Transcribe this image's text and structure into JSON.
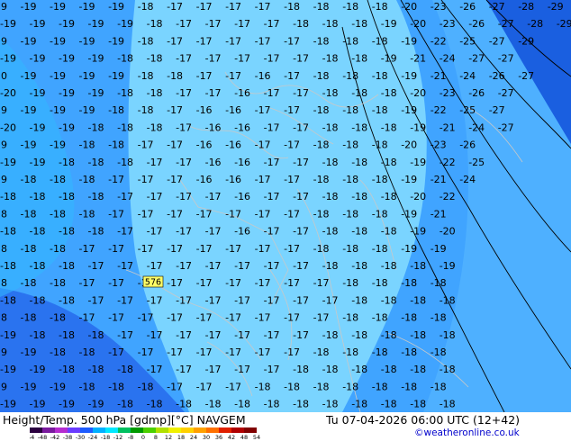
{
  "footer": {
    "title": "Height/Temp. 500 hPa [gdmp][°C] NAVGEM",
    "valid": "Tu 07-04-2026 06:00 UTC (12+42)",
    "copyright": "©weatheronline.co.uk"
  },
  "colorbar": {
    "labels": [
      "-54",
      "-48",
      "-42",
      "-38",
      "-30",
      "-24",
      "-18",
      "-12",
      "-8",
      "0",
      "8",
      "12",
      "18",
      "24",
      "30",
      "36",
      "42",
      "48",
      "54"
    ],
    "colors": [
      "#2b0040",
      "#7a1a9e",
      "#b52ccf",
      "#6a3cff",
      "#1e5cff",
      "#00b0ff",
      "#00e8ff",
      "#00c060",
      "#009a00",
      "#4bd000",
      "#b0e000",
      "#f0f000",
      "#ffd000",
      "#ffa000",
      "#ff7000",
      "#e02000",
      "#b00000",
      "#800000"
    ]
  },
  "map": {
    "label_box": "576",
    "colors": {
      "deep_blue": "#1a5fe0",
      "mid_blue": "#40a4ff",
      "light_blue": "#7ad4ff",
      "cyan": "#00c8ff"
    },
    "rows": [
      [
        "19",
        "19",
        "19",
        "19",
        "19",
        "18",
        "17",
        "17",
        "17",
        "17",
        "18",
        "18",
        "18",
        "18",
        "20",
        "23",
        "26",
        "27",
        "28",
        "29"
      ],
      [
        "19",
        "19",
        "19",
        "19",
        "19",
        "18",
        "17",
        "17",
        "17",
        "17",
        "18",
        "18",
        "18",
        "19",
        "20",
        "23",
        "26",
        "27",
        "28",
        "29"
      ],
      [
        "19",
        "19",
        "19",
        "19",
        "19",
        "18",
        "17",
        "17",
        "17",
        "17",
        "17",
        "18",
        "18",
        "18",
        "19",
        "22",
        "25",
        "27",
        "29"
      ],
      [
        "19",
        "19",
        "19",
        "19",
        "18",
        "18",
        "17",
        "17",
        "17",
        "17",
        "17",
        "18",
        "18",
        "19",
        "21",
        "24",
        "27",
        "27"
      ],
      [
        "20",
        "19",
        "19",
        "19",
        "19",
        "18",
        "18",
        "17",
        "17",
        "16",
        "17",
        "18",
        "18",
        "18",
        "19",
        "21",
        "24",
        "26",
        "27"
      ],
      [
        "20",
        "19",
        "19",
        "19",
        "18",
        "18",
        "17",
        "17",
        "16",
        "17",
        "17",
        "18",
        "18",
        "18",
        "20",
        "23",
        "26",
        "27"
      ],
      [
        "19",
        "19",
        "19",
        "19",
        "18",
        "18",
        "17",
        "16",
        "16",
        "17",
        "17",
        "18",
        "18",
        "18",
        "19",
        "22",
        "25",
        "27"
      ],
      [
        "20",
        "19",
        "19",
        "18",
        "18",
        "18",
        "17",
        "16",
        "16",
        "17",
        "17",
        "18",
        "18",
        "18",
        "19",
        "21",
        "24",
        "27"
      ],
      [
        "19",
        "19",
        "19",
        "18",
        "18",
        "17",
        "17",
        "16",
        "16",
        "17",
        "17",
        "18",
        "18",
        "18",
        "20",
        "23",
        "26"
      ],
      [
        "19",
        "19",
        "18",
        "18",
        "18",
        "17",
        "17",
        "16",
        "16",
        "17",
        "17",
        "18",
        "18",
        "18",
        "19",
        "22",
        "25"
      ],
      [
        "19",
        "18",
        "18",
        "18",
        "17",
        "17",
        "17",
        "16",
        "16",
        "17",
        "17",
        "18",
        "18",
        "18",
        "19",
        "21",
        "24"
      ],
      [
        "18",
        "18",
        "18",
        "18",
        "17",
        "17",
        "17",
        "17",
        "16",
        "17",
        "17",
        "18",
        "18",
        "18",
        "20",
        "22"
      ],
      [
        "18",
        "18",
        "18",
        "18",
        "17",
        "17",
        "17",
        "17",
        "17",
        "17",
        "17",
        "18",
        "18",
        "18",
        "19",
        "21"
      ],
      [
        "18",
        "18",
        "18",
        "18",
        "17",
        "17",
        "17",
        "17",
        "16",
        "17",
        "17",
        "18",
        "18",
        "18",
        "19",
        "20"
      ],
      [
        "18",
        "18",
        "18",
        "17",
        "17",
        "17",
        "17",
        "17",
        "17",
        "17",
        "17",
        "18",
        "18",
        "18",
        "19",
        "19"
      ],
      [
        "18",
        "18",
        "18",
        "17",
        "17",
        "17",
        "17",
        "17",
        "17",
        "17",
        "17",
        "18",
        "18",
        "18",
        "18",
        "19"
      ],
      [
        "18",
        "18",
        "18",
        "17",
        "17",
        "17",
        "17",
        "17",
        "17",
        "17",
        "17",
        "17",
        "18",
        "18",
        "18",
        "18"
      ],
      [
        "18",
        "18",
        "18",
        "17",
        "17",
        "17",
        "17",
        "17",
        "17",
        "17",
        "17",
        "17",
        "18",
        "18",
        "18",
        "18"
      ],
      [
        "18",
        "18",
        "18",
        "17",
        "17",
        "17",
        "17",
        "17",
        "17",
        "17",
        "17",
        "17",
        "18",
        "18",
        "18",
        "18"
      ],
      [
        "19",
        "18",
        "18",
        "18",
        "17",
        "17",
        "17",
        "17",
        "17",
        "17",
        "17",
        "18",
        "18",
        "18",
        "18",
        "18"
      ],
      [
        "19",
        "19",
        "18",
        "18",
        "17",
        "17",
        "17",
        "17",
        "17",
        "17",
        "17",
        "18",
        "18",
        "18",
        "18",
        "18"
      ],
      [
        "19",
        "19",
        "18",
        "18",
        "18",
        "17",
        "17",
        "17",
        "17",
        "17",
        "18",
        "18",
        "18",
        "18",
        "18",
        "18"
      ],
      [
        "19",
        "19",
        "19",
        "18",
        "18",
        "18",
        "17",
        "17",
        "17",
        "18",
        "18",
        "18",
        "18",
        "18",
        "18",
        "18"
      ],
      [
        "19",
        "19",
        "19",
        "19",
        "18",
        "18",
        "18",
        "18",
        "18",
        "18",
        "18",
        "18",
        "18",
        "18",
        "18",
        "18"
      ]
    ]
  }
}
